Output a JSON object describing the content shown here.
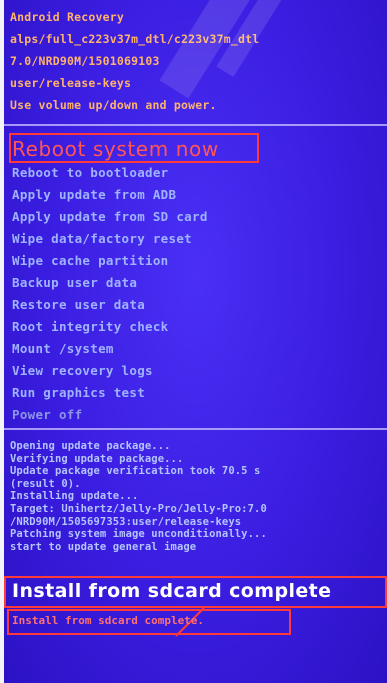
{
  "header": {
    "lines": [
      "Android Recovery",
      "alps/full_c223v37m_dtl/c223v37m_dtl",
      "7.0/NRD90M/1501069103",
      "user/release-keys",
      "Use volume up/down and power."
    ]
  },
  "menu": {
    "items": [
      {
        "label": "Reboot system now",
        "selected": true
      },
      {
        "label": "Reboot to bootloader"
      },
      {
        "label": "Apply update from ADB"
      },
      {
        "label": "Apply update from SD card"
      },
      {
        "label": "Wipe data/factory reset"
      },
      {
        "label": "Wipe cache partition"
      },
      {
        "label": "Backup user data"
      },
      {
        "label": "Restore user data"
      },
      {
        "label": "Root integrity check"
      },
      {
        "label": "Mount /system"
      },
      {
        "label": "View recovery logs"
      },
      {
        "label": "Run graphics test"
      },
      {
        "label": "Power off"
      }
    ]
  },
  "log": {
    "lines": [
      "Opening update package...",
      "Verifying update package...",
      "Update package verification took 70.5 s",
      "(result 0).",
      "Installing update...",
      "Target: Unihertz/Jelly-Pro/Jelly-Pro:7.0",
      "/NRD90M/1505697353:user/release-keys",
      "Patching system image unconditionally...",
      "start to update general image"
    ]
  },
  "overlay_message": "Install from sdcard complete",
  "final_message": "Install from sdcard complete.",
  "colors": {
    "screen_bg": "#3c1ee6",
    "header_text": "#ffb36a",
    "menu_text": "#9fb3ff",
    "selected_text": "#ff5555",
    "highlight_box": "#ff3a3a"
  }
}
